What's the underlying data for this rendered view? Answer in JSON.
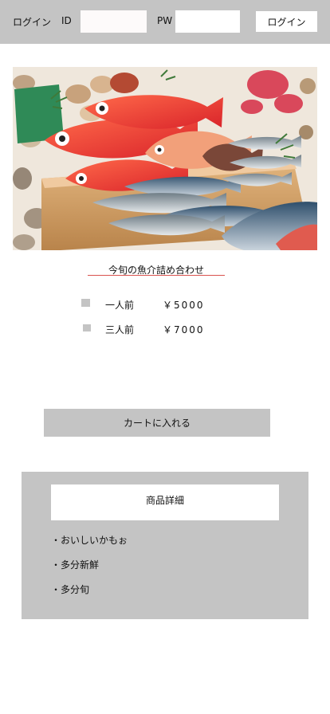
{
  "header": {
    "login_text": "ログイン",
    "id_label": "ID",
    "pw_label": "PW",
    "id_value": "",
    "pw_value": "",
    "login_button": "ログイン"
  },
  "product": {
    "title": "今旬の魚介詰め合わせ",
    "options": [
      {
        "name": "一人前",
        "price": "￥5000"
      },
      {
        "name": "三人前",
        "price": "￥7000"
      }
    ],
    "cart_button": "カートに入れる"
  },
  "details": {
    "heading": "商品詳細",
    "items": [
      "・おいしいかもぉ",
      "・多分新鮮",
      "・多分旬"
    ]
  },
  "colors": {
    "bar_gray": "#c4c4c4",
    "title_underline": "#d9534f"
  }
}
